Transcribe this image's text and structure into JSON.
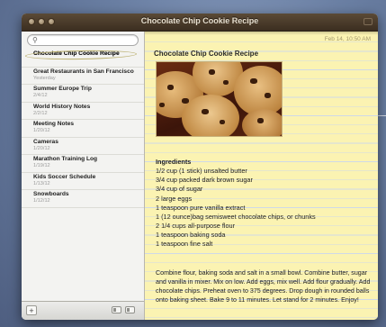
{
  "window": {
    "title": "Chocolate Chip Cookie Recipe"
  },
  "search": {
    "placeholder": ""
  },
  "notes": [
    {
      "title": "Chocolate Chip Cookie Recipe",
      "date": ""
    },
    {
      "title": "Great Restaurants in San Francisco",
      "date": "Yesterday"
    },
    {
      "title": "Summer Europe Trip",
      "date": "2/4/12"
    },
    {
      "title": "World History Notes",
      "date": "2/2/12"
    },
    {
      "title": "Meeting Notes",
      "date": "1/20/12"
    },
    {
      "title": "Cameras",
      "date": "1/20/12"
    },
    {
      "title": "Marathon Training Log",
      "date": "1/19/12"
    },
    {
      "title": "Kids Soccer Schedule",
      "date": "1/13/12"
    },
    {
      "title": "Snowboards",
      "date": "1/12/12"
    }
  ],
  "sidebar_bottom": {
    "add_label": "+"
  },
  "note": {
    "date": "Feb 14, 10:50 AM",
    "title": "Chocolate Chip Cookie Recipe",
    "ingredients_heading": "Ingredients",
    "ingredients": [
      "1/2 cup (1 stick) unsalted butter",
      "3/4 cup packed dark brown sugar",
      "3/4 cup of sugar",
      "2 large eggs",
      "1 teaspoon pure vanilla extract",
      "1 (12 ounce)bag semisweet chocolate chips, or chunks",
      "2 1/4 cups all-purpose flour",
      "1 teaspoon baking soda",
      "1 teaspoon fine salt"
    ],
    "directions": "Combine flour, baking soda and salt in a small bowl. Combine butter, sugar and vanilla in mixer. Mix on low. Add eggs, mix well. Add flour gradually. Add chocolate chips. Preheat oven to 375 degrees. Drop dough in rounded balls onto baking sheet. Bake 9 to 11 minutes. Let stand for 2 minutes. Enjoy!"
  },
  "icons": {
    "search": "search-icon",
    "trash": "trash-icon",
    "share": "share-icon"
  }
}
